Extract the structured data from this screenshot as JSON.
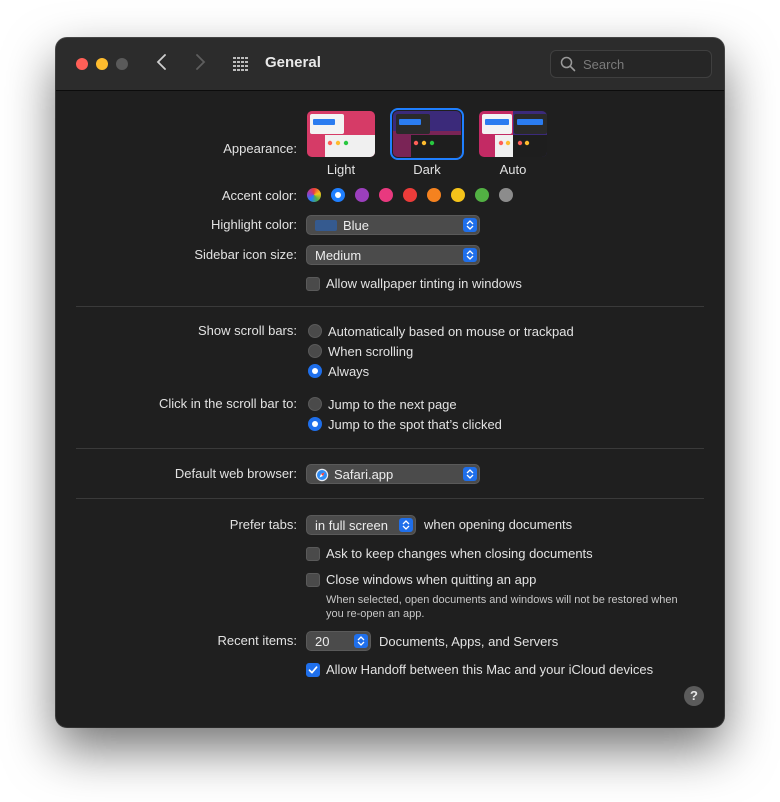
{
  "window": {
    "title": "General"
  },
  "search": {
    "placeholder": "Search"
  },
  "appearance": {
    "label": "Appearance:",
    "options": [
      "Light",
      "Dark",
      "Auto"
    ],
    "selected": "Dark"
  },
  "accent": {
    "label": "Accent color:",
    "colors": [
      "multicolor",
      "#1f7fff",
      "#9b3fbd",
      "#e8397f",
      "#ec3c3a",
      "#f5821f",
      "#f5c31a",
      "#52b043",
      "#8c8c8c"
    ],
    "selected_index": 1
  },
  "highlight": {
    "label": "Highlight color:",
    "value": "Blue",
    "swatch": "#355a8f"
  },
  "sidebar_icon": {
    "label": "Sidebar icon size:",
    "value": "Medium"
  },
  "wallpaper_tint": {
    "label": "Allow wallpaper tinting in windows",
    "checked": false
  },
  "scroll_bars": {
    "label": "Show scroll bars:",
    "options": [
      "Automatically based on mouse or trackpad",
      "When scrolling",
      "Always"
    ],
    "selected": "Always"
  },
  "scroll_click": {
    "label": "Click in the scroll bar to:",
    "options": [
      "Jump to the next page",
      "Jump to the spot that’s clicked"
    ],
    "selected": "Jump to the spot that’s clicked"
  },
  "browser": {
    "label": "Default web browser:",
    "value": "Safari.app"
  },
  "tabs": {
    "label": "Prefer tabs:",
    "value": "in full screen",
    "suffix": "when opening documents"
  },
  "ask_keep": {
    "label": "Ask to keep changes when closing documents",
    "checked": false
  },
  "close_windows": {
    "label": "Close windows when quitting an app",
    "checked": false,
    "note": "When selected, open documents and windows will not be restored when you re-open an app."
  },
  "recent": {
    "label": "Recent items:",
    "value": "20",
    "suffix": "Documents, Apps, and Servers"
  },
  "handoff": {
    "label": "Allow Handoff between this Mac and your iCloud devices",
    "checked": true
  },
  "help": {
    "label": "?"
  },
  "colors": {
    "accent": "#1f6feb",
    "window_bg": "#1f1f1f",
    "titlebar_bg": "#2c2c2c"
  }
}
